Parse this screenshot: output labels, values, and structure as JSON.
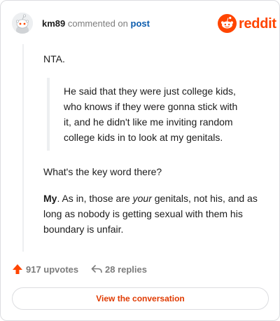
{
  "header": {
    "username": "km89",
    "commented_text": "commented on",
    "post_link": "post",
    "brand_text": "reddit",
    "brand_color": "#ff4500",
    "avatar_icon": "reddit-snoo-avatar-icon"
  },
  "comment": {
    "p1": "NTA.",
    "quote_lines": [
      "He said that they were just college kids,",
      "who knows if they were gonna stick with",
      "it, and he didn't like me inviting random",
      "college kids in to look at my genitals."
    ],
    "p2": "What's the key word there?",
    "p3_bold": "My",
    "p3_part1": ". As in, those are ",
    "p3_italic": "your",
    "p3_line1_rest": " genitals, not his, and as",
    "p3_line2": "long as nobody is getting sexual with them his",
    "p3_line3": "boundary is unfair."
  },
  "stats": {
    "upvotes": "917 upvotes",
    "replies": "28 replies",
    "upvote_icon": "upvote-arrow-icon",
    "reply_icon": "reply-arrow-icon"
  },
  "actions": {
    "view_conversation": "View the conversation"
  }
}
